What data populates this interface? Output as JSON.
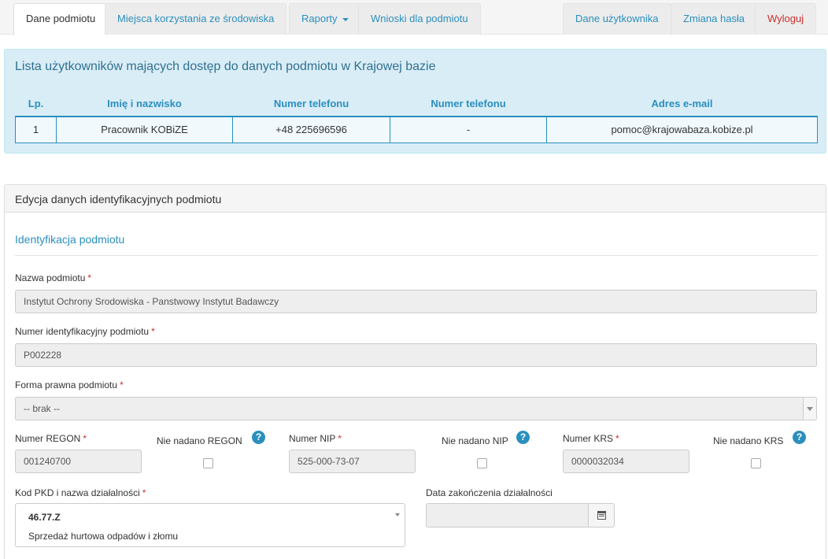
{
  "nav": {
    "tabs": [
      {
        "label": "Dane podmiotu"
      },
      {
        "label": "Miejsca korzystania ze środowiska"
      },
      {
        "label": "Raporty"
      },
      {
        "label": "Wnioski dla podmiotu"
      }
    ],
    "right": [
      {
        "label": "Dane użytkownika"
      },
      {
        "label": "Zmiana hasła"
      },
      {
        "label": "Wyloguj"
      }
    ]
  },
  "users": {
    "title": "Lista użytkowników mających dostęp do danych podmiotu w Krajowej bazie",
    "columns": [
      "Lp.",
      "Imię i nazwisko",
      "Numer telefonu",
      "Numer telefonu",
      "Adres e-mail"
    ],
    "rows": [
      [
        "1",
        "Pracownik KOBiZE",
        "+48 225696596",
        "-",
        "pomoc@krajowabaza.kobize.pl"
      ]
    ]
  },
  "edit": {
    "title": "Edycja danych identyfikacyjnych podmiotu",
    "section": "Identyfikacja podmiotu",
    "name_label": "Nazwa podmiotu",
    "name_value": "Instytut Ochrony Srodowiska - Panstwowy Instytut Badawczy",
    "id_label": "Numer identyfikacyjny podmiotu",
    "id_value": "P002228",
    "legal_label": "Forma prawna podmiotu",
    "legal_value": "-- brak --",
    "regon_label": "Numer REGON",
    "regon_value": "001240700",
    "no_regon_label": "Nie nadano REGON",
    "nip_label": "Numer NIP",
    "nip_value": "525-000-73-07",
    "no_nip_label": "Nie nadano NIP",
    "krs_label": "Numer KRS",
    "krs_value": "0000032034",
    "no_krs_label": "Nie nadano KRS",
    "pkd_label": "Kod PKD i nazwa działalności",
    "pkd_code": "46.77.Z",
    "pkd_name": "Sprzedaż hurtowa odpadów i złomu",
    "end_date_label": "Data zakończenia działalności",
    "end_date_value": "",
    "required_mark": "*",
    "help_mark": "?"
  },
  "colors": {
    "accent": "#2a8fbd",
    "info_bg": "#d9edf7",
    "required": "#c9302c"
  }
}
